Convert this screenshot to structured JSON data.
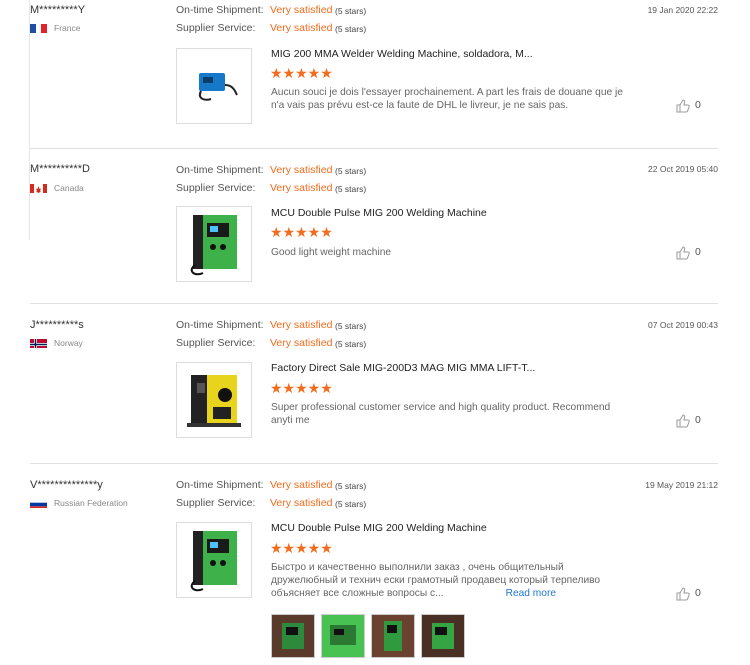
{
  "labels": {
    "shipment": "On-time Shipment:",
    "service": "Supplier Service:"
  },
  "reviews": [
    {
      "user": "M*********Y",
      "country": "France",
      "date": "19 Jan 2020 22:22",
      "shipment": "Very satisfied",
      "shipment_stars": "(5 stars)",
      "service": "Very satisfied",
      "service_stars": "(5 stars)",
      "product_title": "MIG 200 MMA Welder Welding Machine, soldadora, M...",
      "rating": 5,
      "text": "Aucun souci je dois l'essayer prochainement. A part les frais de douane que je n'a vais pas prévu est-ce la faute de DHL le livreur, je ne sais pas.",
      "likes": "0"
    },
    {
      "user": "M**********D",
      "country": "Canada",
      "date": "22 Oct 2019 05:40",
      "shipment": "Very satisfied",
      "shipment_stars": "(5 stars)",
      "service": "Very satisfied",
      "service_stars": "(5 stars)",
      "product_title": "MCU Double Pulse MIG 200 Welding Machine",
      "rating": 5,
      "text": "Good light weight machine",
      "likes": "0"
    },
    {
      "user": "J**********s",
      "country": "Norway",
      "date": "07 Oct 2019 00:43",
      "shipment": "Very satisfied",
      "shipment_stars": "(5 stars)",
      "service": "Very satisfied",
      "service_stars": "(5 stars)",
      "product_title": "Factory Direct Sale MIG-200D3 MAG MIG MMA LIFT-T...",
      "rating": 5,
      "text": "Super professional customer service and high quality product. Recommend anyti me",
      "likes": "0"
    },
    {
      "user": "V**************y",
      "country": "Russian Federation",
      "date": "19 May 2019 21:12",
      "shipment": "Very satisfied",
      "shipment_stars": "(5 stars)",
      "service": "Very satisfied",
      "service_stars": "(5 stars)",
      "product_title": "MCU Double Pulse MIG 200 Welding Machine",
      "rating": 5,
      "text": "Быстро и качественно выполнили заказ , очень общительный дружелюбный и технич ески грамотный продавец который терпеливо объясняет все сложные вопросы с...",
      "read_more": "Read more",
      "likes": "0"
    }
  ],
  "colors": {
    "accent": "#f36b1c",
    "link": "#1f78c8"
  }
}
